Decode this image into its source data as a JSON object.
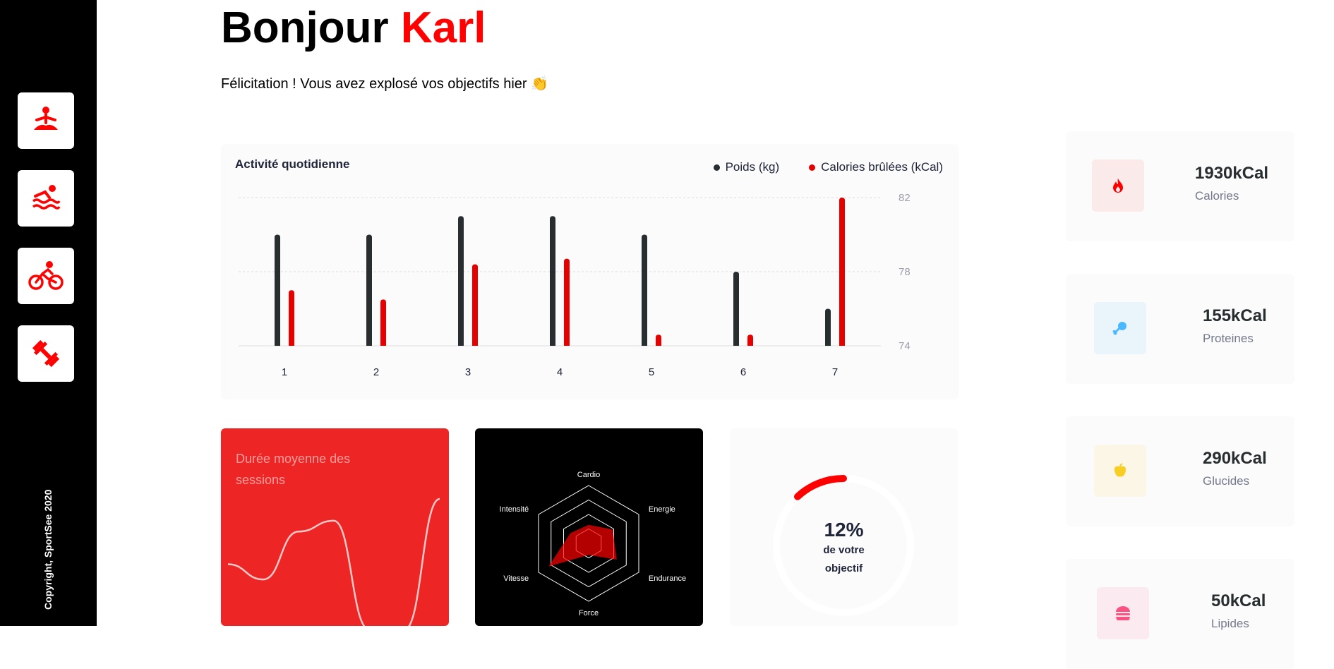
{
  "sidebar": {
    "icons": [
      "yoga-icon",
      "swimming-icon",
      "cycling-icon",
      "dumbbell-icon"
    ],
    "copyright": "Copyright, SportSee 2020"
  },
  "header": {
    "greeting": "Bonjour",
    "name": "Karl",
    "subtitle": "Félicitation ! Vous avez explosé vos objectifs hier 👏"
  },
  "activity": {
    "title": "Activité quotidienne",
    "legend": [
      "Poids (kg)",
      "Calories brûlées (kCal)"
    ]
  },
  "sessions": {
    "title": "Durée moyenne des sessions"
  },
  "score": {
    "percent": "12%",
    "label_line1": "de votre",
    "label_line2": "objectif",
    "value": 0.12
  },
  "nutrition": [
    {
      "value": "1930kCal",
      "label": "Calories",
      "icon": "flame-icon",
      "color": "#ff0000",
      "bg": "#fbeaea"
    },
    {
      "value": "155kCal",
      "label": "Proteines",
      "icon": "chicken-icon",
      "color": "#4ab8ff",
      "bg": "#e9f4fb"
    },
    {
      "value": "290kCal",
      "label": "Glucides",
      "icon": "apple-icon",
      "color": "#f9ce23",
      "bg": "#fbf6e5"
    },
    {
      "value": "50kCal",
      "label": "Lipides",
      "icon": "burger-icon",
      "color": "#fd5181",
      "bg": "#fbeaef"
    }
  ],
  "colors": {
    "accent": "#ff0101",
    "black": "#282d30",
    "red_tile": "#ee2525"
  },
  "chart_data": [
    {
      "type": "bar",
      "title": "Activité quotidienne",
      "categories": [
        "1",
        "2",
        "3",
        "4",
        "5",
        "6",
        "7"
      ],
      "series": [
        {
          "name": "Poids (kg)",
          "values": [
            80,
            80,
            81,
            81,
            80,
            78,
            76
          ],
          "color": "#282d30"
        },
        {
          "name": "Calories brûlées (kCal)",
          "values": [
            77,
            76.5,
            78.4,
            78.7,
            74.6,
            74.6,
            82
          ],
          "color": "#e60000"
        }
      ],
      "yticks": [
        "74",
        "78",
        "82"
      ],
      "ylim": [
        74,
        82
      ]
    },
    {
      "type": "line",
      "title": "Durée moyenne des sessions",
      "x": [
        1,
        2,
        3,
        4,
        5,
        6,
        7
      ],
      "values": [
        30,
        23,
        45,
        50,
        0,
        0,
        60
      ],
      "ylim": [
        0,
        60
      ]
    },
    {
      "type": "radar",
      "categories": [
        "Cardio",
        "Energie",
        "Endurance",
        "Force",
        "Vitesse",
        "Intensité"
      ],
      "values": [
        80,
        120,
        140,
        50,
        200,
        90
      ],
      "rmax": 250
    }
  ]
}
